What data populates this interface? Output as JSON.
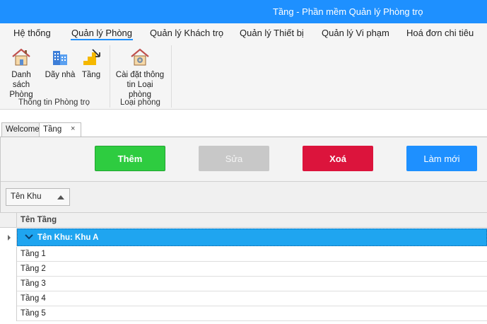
{
  "window": {
    "title": "Tầng - Phần mềm Quản lý Phòng trọ"
  },
  "menu": {
    "items": [
      {
        "label": "Hệ thống"
      },
      {
        "label": "Quản lý Phòng"
      },
      {
        "label": "Quản lý Khách trọ"
      },
      {
        "label": "Quản lý Thiết bị"
      },
      {
        "label": "Quản lý Vi phạm"
      },
      {
        "label": "Hoá đơn chi tiêu"
      }
    ],
    "active": "Quản lý Phòng"
  },
  "ribbon": {
    "groups": [
      {
        "label": "Thông tin Phòng trọ",
        "buttons": [
          {
            "label_line1": "Danh sách",
            "label_line2": "Phòng",
            "icon": "house-icon"
          },
          {
            "label_line1": "Dãy nhà",
            "icon": "building-icon"
          },
          {
            "label_line1": "Tầng",
            "icon": "stairs-icon"
          }
        ]
      },
      {
        "label": "Loại phòng",
        "buttons": [
          {
            "label_line1": "Cài đặt thông",
            "label_line2": "tin Loại phòng",
            "icon": "house-settings-icon"
          }
        ]
      }
    ]
  },
  "tabs": [
    {
      "label": "Welcome",
      "active": false
    },
    {
      "label": "Tầng",
      "active": true,
      "close": "×"
    }
  ],
  "actions": {
    "add": "Thêm",
    "edit": "Sửa",
    "delete": "Xoá",
    "refresh": "Làm mới"
  },
  "group_panel": {
    "chip": "Tên Khu"
  },
  "grid": {
    "column": "Tên Tầng",
    "group_label": "Tên Khu: Khu A",
    "rows": [
      "Tầng 1",
      "Tầng 2",
      "Tầng 3",
      "Tầng 4",
      "Tầng 5"
    ]
  },
  "colors": {
    "titlebar": "#1e90ff",
    "add": "#2ecc40",
    "edit_disabled": "#c8c8c8",
    "delete": "#dc143c",
    "refresh": "#1e90ff",
    "group_row": "#1fa5f0"
  }
}
